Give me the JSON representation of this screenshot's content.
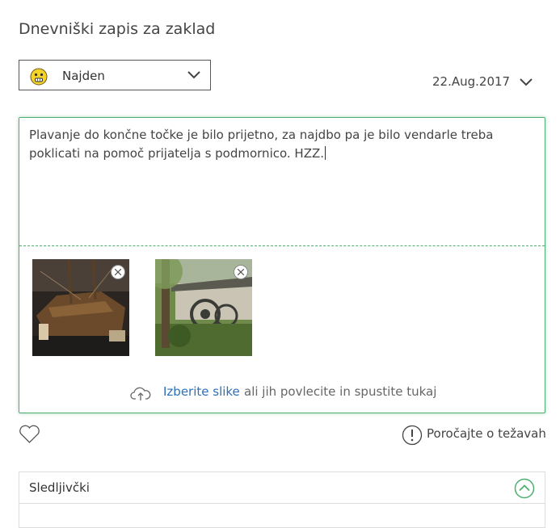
{
  "page": {
    "title": "Dnevniški zapis za zaklad"
  },
  "log_type": {
    "selected": "Najden",
    "icon": "smiley-icon"
  },
  "date": {
    "value": "22.Aug.2017"
  },
  "editor": {
    "text": "Plavanje do končne točke je bilo prijetno, za najdbo pa je bilo vendarle treba poklicati na pomoč prijatelja s podmornico. HZZ.",
    "images": [
      {
        "subject": "wooden ship in museum"
      },
      {
        "subject": "house with water wheel and trees"
      }
    ],
    "upload": {
      "link": "Izberite slike",
      "hint": "ali jih povlecite in spustite tukaj"
    }
  },
  "actions": {
    "favorite_icon": "heart-icon",
    "report_label": "Poročajte o težavah"
  },
  "trackables": {
    "title": "Sledljivčki"
  },
  "colors": {
    "accent_green": "#4caf6f",
    "link_blue": "#2b70b8"
  }
}
